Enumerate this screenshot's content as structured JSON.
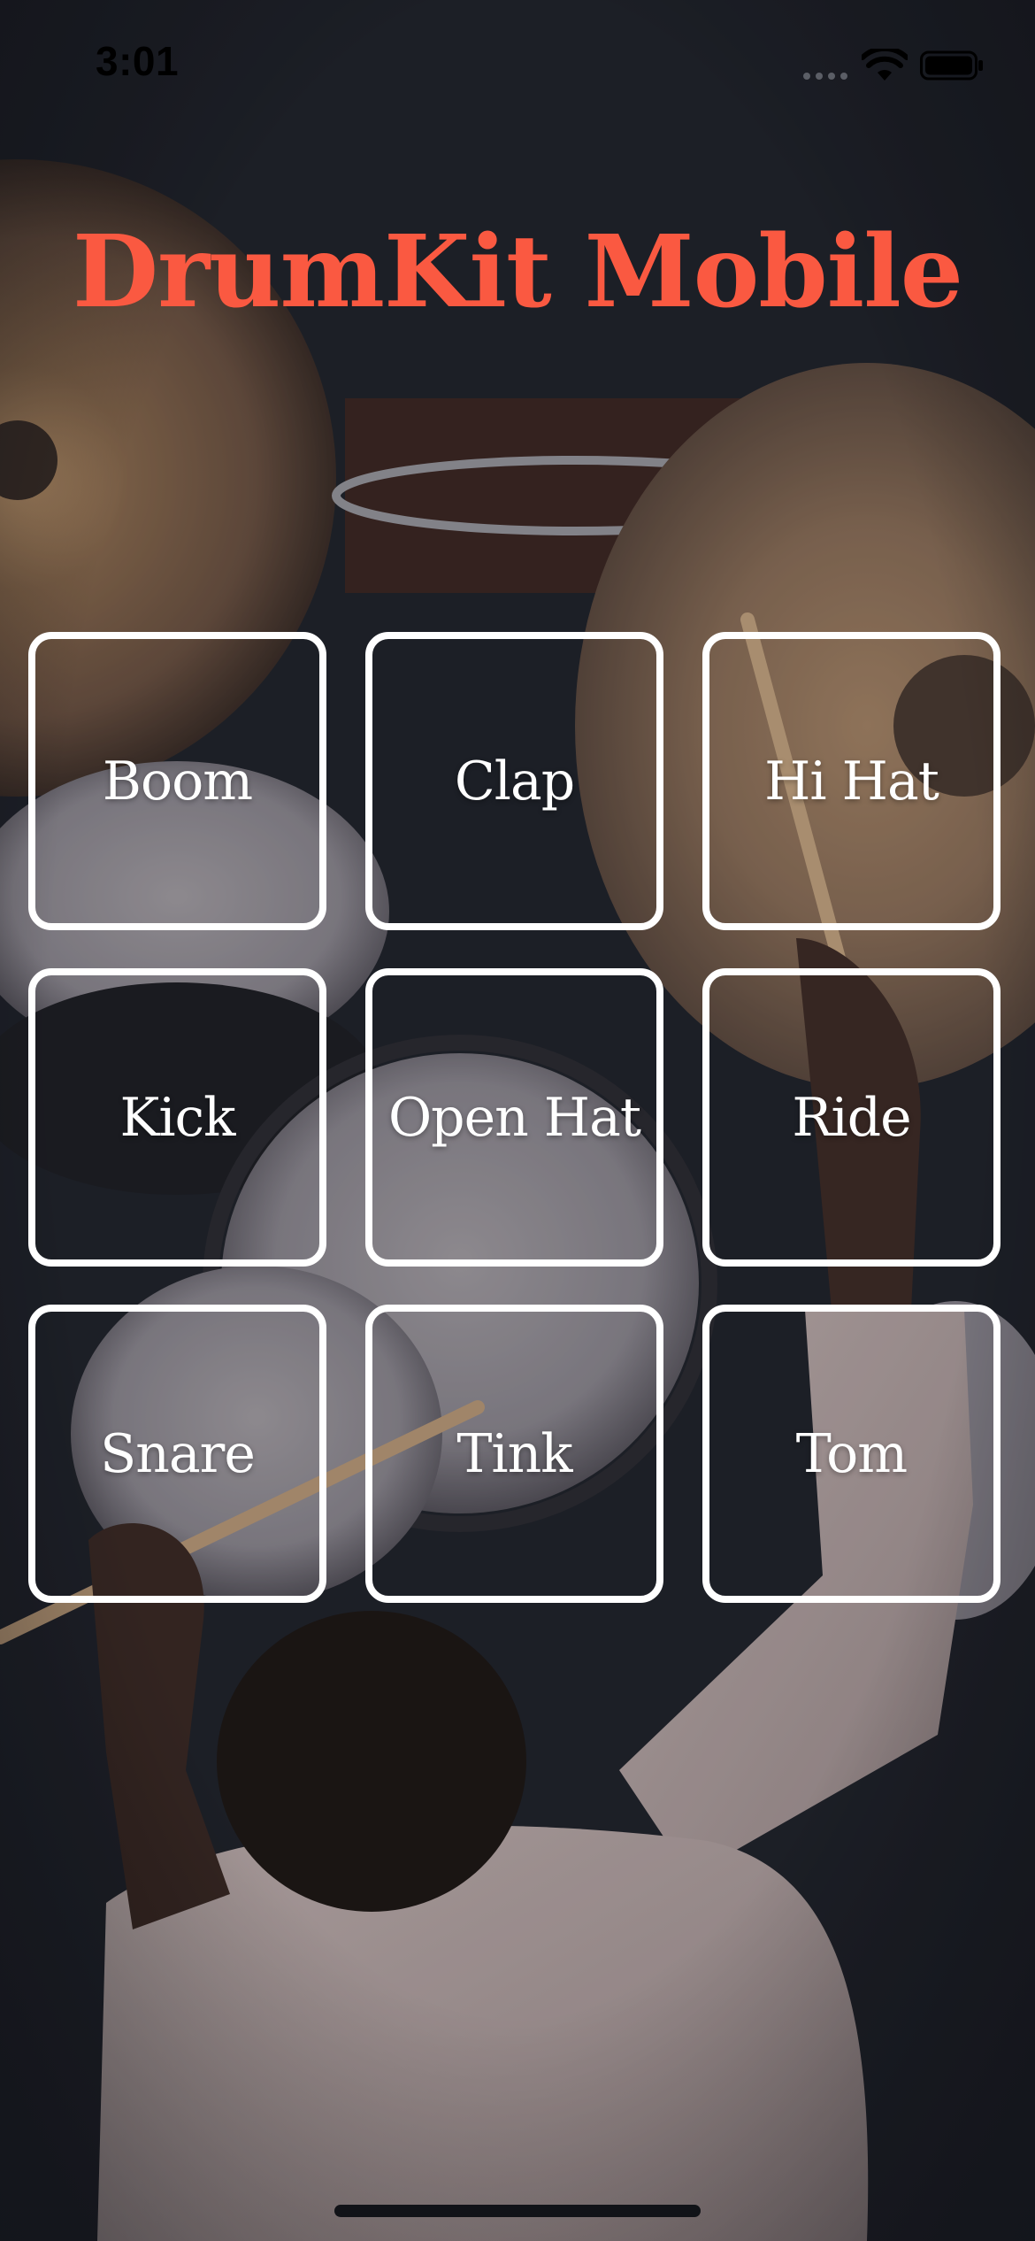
{
  "status_bar": {
    "time": "3:01",
    "icons": [
      "signal-icon",
      "wifi-icon",
      "battery-icon"
    ]
  },
  "app": {
    "title": "DrumKit Mobile",
    "accent_color": "#fa5941"
  },
  "pads": [
    {
      "label": "Boom"
    },
    {
      "label": "Clap"
    },
    {
      "label": "Hi Hat"
    },
    {
      "label": "Kick"
    },
    {
      "label": "Open Hat"
    },
    {
      "label": "Ride"
    },
    {
      "label": "Snare"
    },
    {
      "label": "Tink"
    },
    {
      "label": "Tom"
    }
  ],
  "background": {
    "description_icon": "drummer-photo"
  }
}
